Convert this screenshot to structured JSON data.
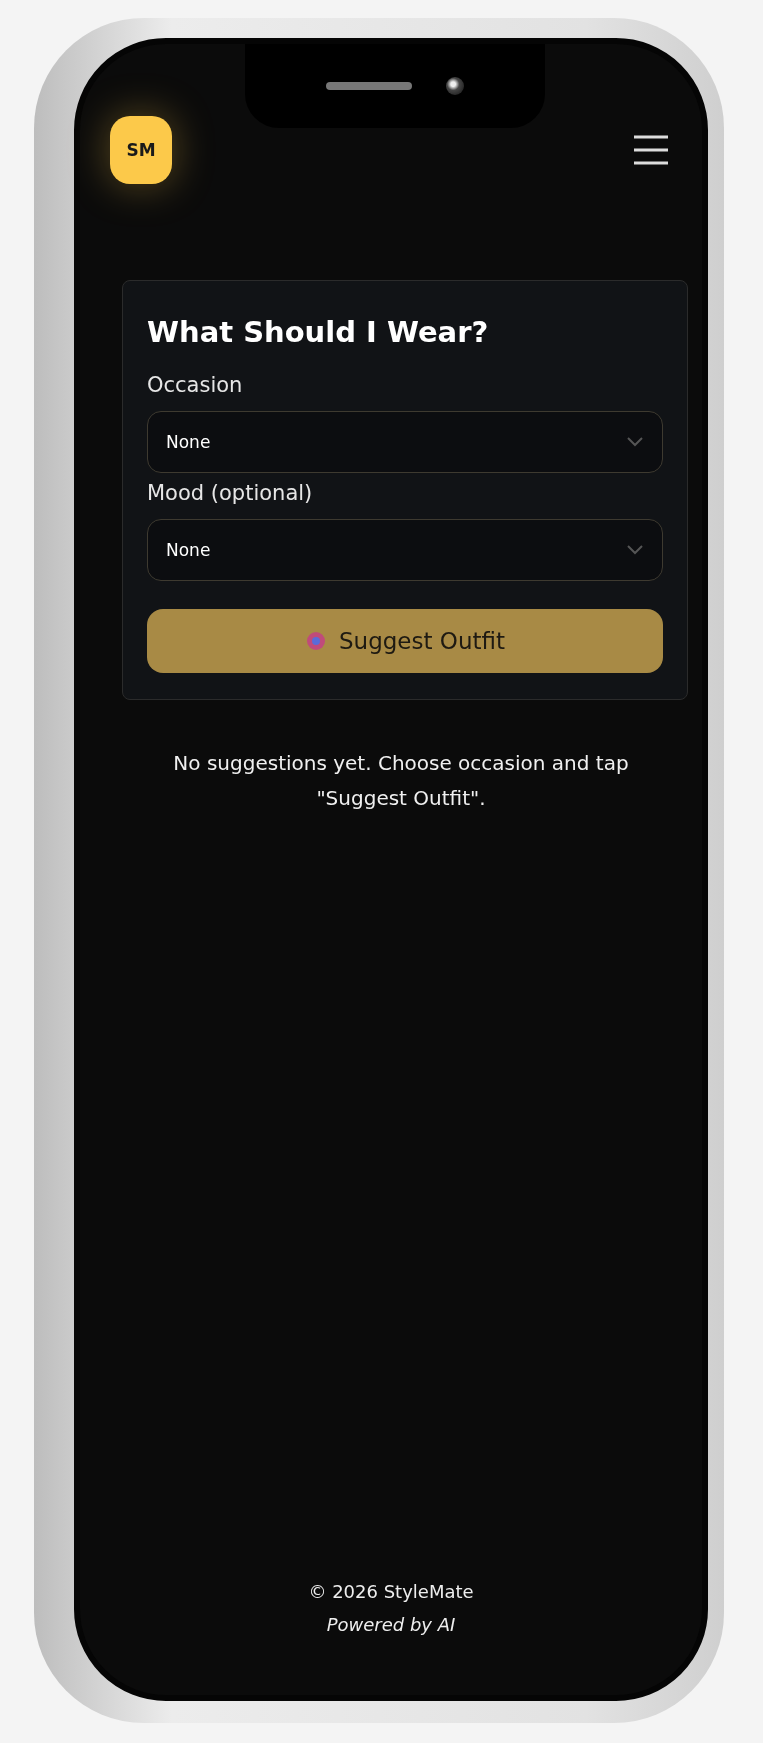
{
  "header": {
    "logo": "SM"
  },
  "card": {
    "title": "What Should I Wear?",
    "fields": [
      {
        "label": "Occasion",
        "value": "None"
      },
      {
        "label": "Mood (optional)",
        "value": "None"
      }
    ],
    "button": "Suggest Outfit"
  },
  "empty_message": "No suggestions yet. Choose occasion and tap \"Suggest Outfit\".",
  "footer": {
    "copyright": "© 2026 StyleMate",
    "tagline": "Powered by AI"
  }
}
